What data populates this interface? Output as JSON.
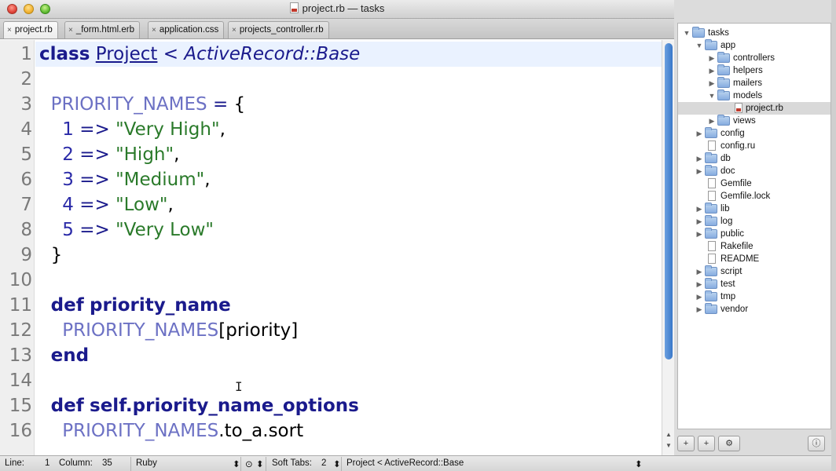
{
  "window": {
    "title": "project.rb — tasks"
  },
  "tabs": [
    {
      "label": "project.rb",
      "active": true
    },
    {
      "label": "_form.html.erb",
      "active": false
    },
    {
      "label": "application.css",
      "active": false
    },
    {
      "label": "projects_controller.rb",
      "active": false
    }
  ],
  "editor": {
    "line_numbers": [
      "1",
      "2",
      "3",
      "4",
      "5",
      "6",
      "7",
      "8",
      "9",
      "10",
      "11",
      "12",
      "13",
      "14",
      "15",
      "16"
    ],
    "code": {
      "l1_class": "class",
      "l1_name": "Project",
      "l1_lt": "<",
      "l1_super": "ActiveRecord::Base",
      "l3_const": "PRIORITY_NAMES",
      "l3_eq": "=",
      "l3_brace": "{",
      "l4_num": "1",
      "l4_arrow": "=>",
      "l4_str": "\"Very High\"",
      "l4_comma": ",",
      "l5_num": "2",
      "l5_arrow": "=>",
      "l5_str": "\"High\"",
      "l5_comma": ",",
      "l6_num": "3",
      "l6_arrow": "=>",
      "l6_str": "\"Medium\"",
      "l6_comma": ",",
      "l7_num": "4",
      "l7_arrow": "=>",
      "l7_str": "\"Low\"",
      "l7_comma": ",",
      "l8_num": "5",
      "l8_arrow": "=>",
      "l8_str": "\"Very Low\"",
      "l9_brace": "}",
      "l11_def": "def",
      "l11_name": "priority_name",
      "l12_const": "PRIORITY_NAMES",
      "l12_rest": "[priority]",
      "l13_end": "end",
      "l15_def": "def",
      "l15_name": "self.priority_name_options",
      "l16_const": "PRIORITY_NAMES",
      "l16_rest": ".to_a.sort"
    },
    "cursor_glyph": "I"
  },
  "statusbar": {
    "line_label": "Line:",
    "line_value": "1",
    "column_label": "Column:",
    "column_value": "35",
    "language": "Ruby",
    "soft_tabs_label": "Soft Tabs:",
    "soft_tabs_value": "2",
    "symbol": "Project < ActiveRecord::Base"
  },
  "project_tree": [
    {
      "label": "tasks",
      "type": "folder",
      "depth": 0,
      "expanded": true
    },
    {
      "label": "app",
      "type": "folder",
      "depth": 1,
      "expanded": true
    },
    {
      "label": "controllers",
      "type": "folder",
      "depth": 2,
      "expanded": false
    },
    {
      "label": "helpers",
      "type": "folder",
      "depth": 2,
      "expanded": false
    },
    {
      "label": "mailers",
      "type": "folder",
      "depth": 2,
      "expanded": false
    },
    {
      "label": "models",
      "type": "folder",
      "depth": 2,
      "expanded": true
    },
    {
      "label": "project.rb",
      "type": "ruby-file",
      "depth": 3,
      "selected": true
    },
    {
      "label": "views",
      "type": "folder",
      "depth": 2,
      "expanded": false
    },
    {
      "label": "config",
      "type": "folder",
      "depth": 1,
      "expanded": false
    },
    {
      "label": "config.ru",
      "type": "file",
      "depth": 1
    },
    {
      "label": "db",
      "type": "folder",
      "depth": 1,
      "expanded": false
    },
    {
      "label": "doc",
      "type": "folder",
      "depth": 1,
      "expanded": false
    },
    {
      "label": "Gemfile",
      "type": "file",
      "depth": 1
    },
    {
      "label": "Gemfile.lock",
      "type": "file",
      "depth": 1
    },
    {
      "label": "lib",
      "type": "folder",
      "depth": 1,
      "expanded": false
    },
    {
      "label": "log",
      "type": "folder",
      "depth": 1,
      "expanded": false
    },
    {
      "label": "public",
      "type": "folder",
      "depth": 1,
      "expanded": false
    },
    {
      "label": "Rakefile",
      "type": "file",
      "depth": 1
    },
    {
      "label": "README",
      "type": "file",
      "depth": 1
    },
    {
      "label": "script",
      "type": "folder",
      "depth": 1,
      "expanded": false
    },
    {
      "label": "test",
      "type": "folder",
      "depth": 1,
      "expanded": false
    },
    {
      "label": "tmp",
      "type": "folder",
      "depth": 1,
      "expanded": false
    },
    {
      "label": "vendor",
      "type": "folder",
      "depth": 1,
      "expanded": false
    }
  ],
  "icons": {
    "close_tab": "×",
    "updown": "⬍",
    "gear": "⚙",
    "info": "ⓘ",
    "add_file": "+",
    "add_folder": "+",
    "expanded": "▼",
    "collapsed": "▶",
    "scroll_up": "▲",
    "scroll_down": "▼",
    "tab_size_menu": "⊙"
  },
  "colors": {
    "keyword": "#1a1a8c",
    "constant": "#6c71c4",
    "string": "#2a7a2a",
    "number": "#2b2ba8",
    "current_line": "#eaf2ff",
    "scroll_thumb": "#3a78c9"
  }
}
